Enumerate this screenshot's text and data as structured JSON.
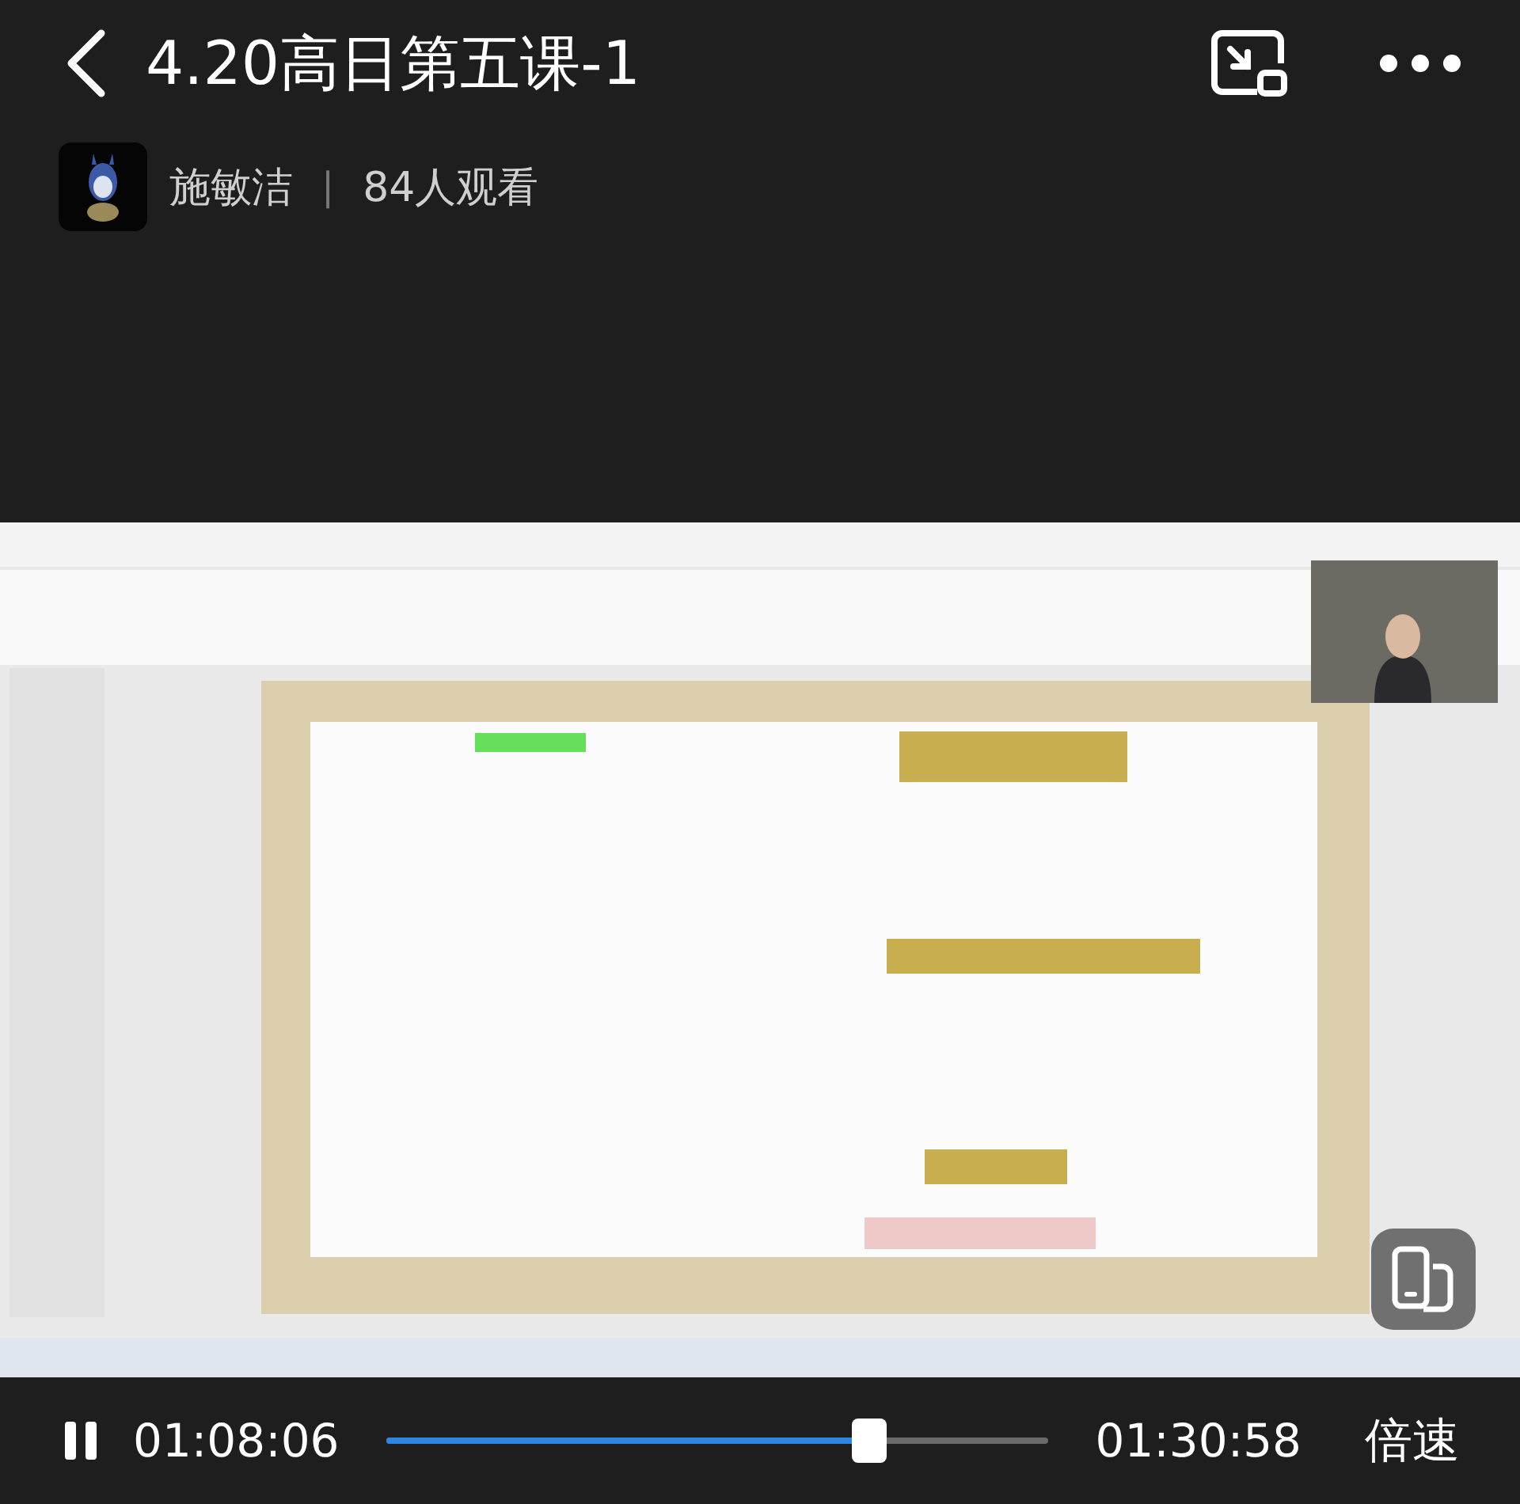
{
  "header": {
    "title": "4.20高日第五课-1"
  },
  "host": {
    "name": "施敏洁",
    "separator": "|",
    "viewers": "84人观看"
  },
  "controls": {
    "playing": true,
    "elapsed": "01:08:06",
    "level": 0.73,
    "duration": "01:30:58",
    "speed": "倍速"
  }
}
